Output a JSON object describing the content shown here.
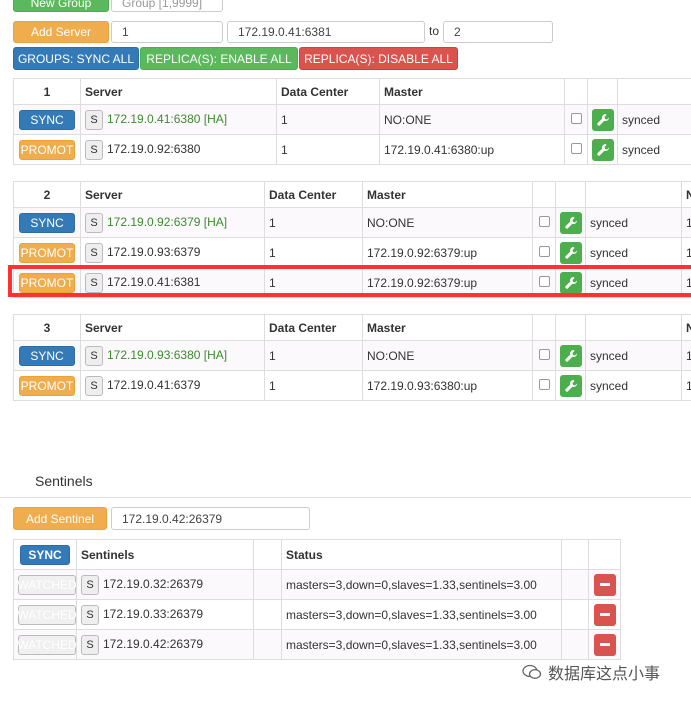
{
  "toolbar": {
    "new_group_label": "New Group",
    "group_placeholder": "Group [1,9999]",
    "add_server_label": "Add Server",
    "group_value": "1",
    "server_value": "172.19.0.41:6381",
    "to_label": "to",
    "target_value": "2",
    "sync_all_label": "GROUPS: SYNC ALL",
    "enable_all_label": "REPLICA(S): ENABLE ALL",
    "disable_all_label": "REPLICA(S): DISABLE ALL"
  },
  "headers": {
    "server": "Server",
    "dc": "Data Center",
    "master": "Master",
    "last": "N"
  },
  "groups": [
    {
      "id": "1",
      "rows": [
        {
          "action": "SYNC",
          "s": "S",
          "server": "172.19.0.41:6380 [HA]",
          "dc": "1",
          "master": "NO:ONE",
          "status": "synced"
        },
        {
          "action": "PROMOT",
          "s": "S",
          "server": "172.19.0.92:6380",
          "dc": "1",
          "master": "172.19.0.41:6380:up",
          "status": "synced"
        }
      ]
    },
    {
      "id": "2",
      "rows": [
        {
          "action": "SYNC",
          "s": "S",
          "server": "172.19.0.92:6379 [HA]",
          "dc": "1",
          "master": "NO:ONE",
          "status": "synced",
          "extra": "1"
        },
        {
          "action": "PROMOT",
          "s": "S",
          "server": "172.19.0.93:6379",
          "dc": "1",
          "master": "172.19.0.92:6379:up",
          "status": "synced",
          "extra": "1"
        },
        {
          "action": "PROMOT",
          "s": "S",
          "server": "172.19.0.41:6381",
          "dc": "1",
          "master": "172.19.0.92:6379:up",
          "status": "synced",
          "extra": "1"
        }
      ]
    },
    {
      "id": "3",
      "rows": [
        {
          "action": "SYNC",
          "s": "S",
          "server": "172.19.0.93:6380 [HA]",
          "dc": "1",
          "master": "NO:ONE",
          "status": "synced",
          "extra": "1"
        },
        {
          "action": "PROMOT",
          "s": "S",
          "server": "172.19.0.41:6379",
          "dc": "1",
          "master": "172.19.0.93:6380:up",
          "status": "synced",
          "extra": "1"
        }
      ]
    }
  ],
  "sentinels": {
    "title": "Sentinels",
    "add_label": "Add Sentinel",
    "input_value": "172.19.0.42:26379",
    "sync_label": "SYNC",
    "col_sentinels": "Sentinels",
    "col_status": "Status",
    "rows": [
      {
        "action": "WATCHED",
        "s": "S",
        "addr": "172.19.0.32:26379",
        "status": "masters=3,down=0,slaves=1.33,sentinels=3.00"
      },
      {
        "action": "WATCHED",
        "s": "S",
        "addr": "172.19.0.33:26379",
        "status": "masters=3,down=0,slaves=1.33,sentinels=3.00"
      },
      {
        "action": "WATCHED",
        "s": "S",
        "addr": "172.19.0.42:26379",
        "status": "masters=3,down=0,slaves=1.33,sentinels=3.00"
      }
    ]
  },
  "watermark": "数据库这点小事",
  "colors": {
    "green": "#5cb85c",
    "orange": "#f0ad4e",
    "blue": "#337ab7",
    "red": "#d9534f",
    "highlight": "#ff3232"
  },
  "icons": {
    "config": "wrench-icon",
    "remove": "minus-icon",
    "watermark": "wechat-icon"
  }
}
